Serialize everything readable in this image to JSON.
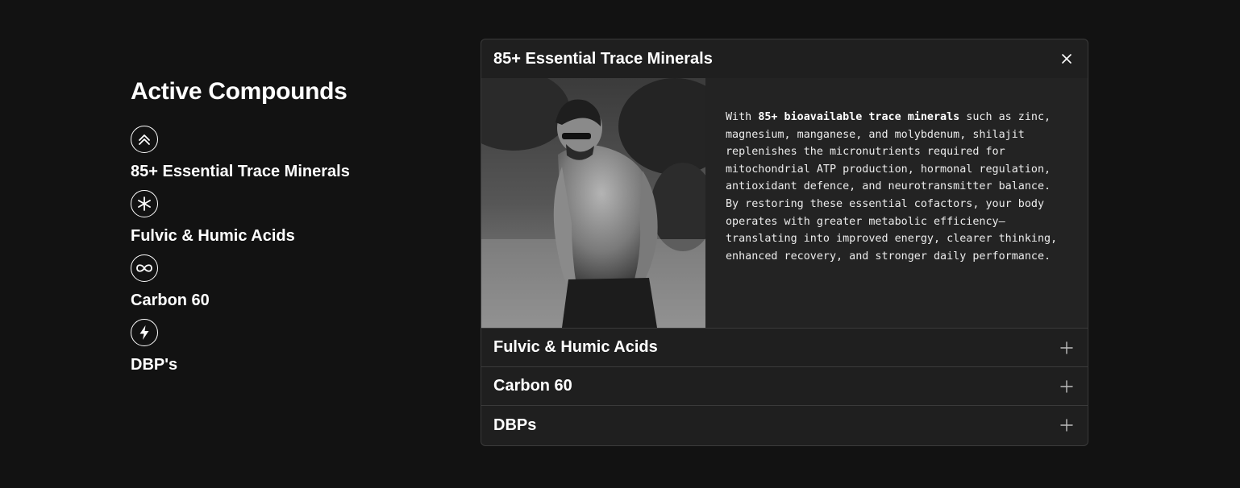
{
  "left": {
    "title": "Active Compounds",
    "compounds": [
      {
        "label": "85+ Essential Trace Minerals",
        "icon": "double-chevron-up-icon"
      },
      {
        "label": "Fulvic & Humic Acids",
        "icon": "asterisk-icon"
      },
      {
        "label": "Carbon 60",
        "icon": "infinity-icon"
      },
      {
        "label": "DBP's",
        "icon": "lightning-bolt-icon"
      }
    ]
  },
  "accordion": {
    "open_item": {
      "title": "85+ Essential Trace Minerals",
      "toggle_icon": "close-icon",
      "body_intro": "With ",
      "body_bold": "85+ bioavailable trace minerals",
      "body_rest": " such as zinc, magnesium, manganese, and molybdenum, shilajit replenishes the micronutrients required for mitochondrial ATP production, hormonal regulation, antioxidant defence, and neurotransmitter balance.",
      "body_second": "By restoring these essential cofactors, your body operates with greater metabolic efficiency—translating into improved energy, clearer thinking, enhanced recovery, and stronger daily performance."
    },
    "items": [
      {
        "title": "Fulvic & Humic Acids",
        "toggle_icon": "plus-icon"
      },
      {
        "title": "Carbon 60",
        "toggle_icon": "plus-icon"
      },
      {
        "title": "DBPs",
        "toggle_icon": "plus-icon"
      }
    ]
  },
  "colors": {
    "background": "#121212",
    "panel": "#1f1f1f",
    "border": "#3a3a3a",
    "text": "#ffffff"
  }
}
